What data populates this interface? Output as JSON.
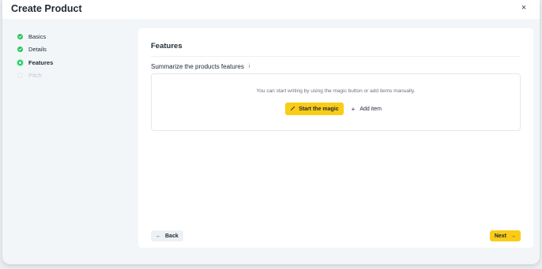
{
  "dialog": {
    "title": "Create Product",
    "close_label": "×"
  },
  "steps": [
    {
      "label": "Basics",
      "status": "done"
    },
    {
      "label": "Details",
      "status": "done"
    },
    {
      "label": "Features",
      "status": "current"
    },
    {
      "label": "Pitch",
      "status": "pending"
    }
  ],
  "card": {
    "title": "Features",
    "section_label": "Summarize the products features",
    "info_icon": "i",
    "hint": "You can start writing by using the magic button or add items manually.",
    "magic_button": "Start the magic",
    "add_button": "Add item"
  },
  "footer": {
    "back_label": "Back",
    "next_label": "Next"
  },
  "icons": {
    "magic": "magic-wand-icon",
    "add": "plus-icon",
    "back": "arrow-left-icon",
    "next": "arrow-right-icon",
    "close": "close-icon",
    "info": "info-icon"
  },
  "colors": {
    "accent": "#facc15",
    "done": "#22c55e",
    "background": "#f3f6f9"
  }
}
